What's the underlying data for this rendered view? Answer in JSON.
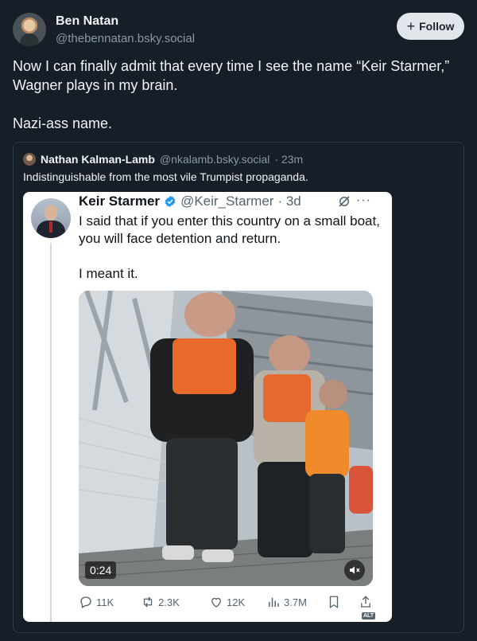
{
  "post": {
    "author_name": "Ben Natan",
    "author_handle": "@thebennatan.bsky.social",
    "follow_label": "Follow",
    "text_lines": [
      "Now I can finally admit that every time I see the name “Keir Starmer,” Wagner plays in my brain.",
      "Nazi-ass name."
    ]
  },
  "quote": {
    "author_name": "Nathan Kalman-Lamb",
    "author_handle": "@nkalamb.bsky.social",
    "time": "· 23m",
    "text": "Indistinguishable from the most vile Trumpist propaganda."
  },
  "embedded": {
    "author_name": "Keir Starmer",
    "author_handle": "@Keir_Starmer",
    "time": "· 3d",
    "text_lines": [
      "I said that if you enter this country on a small boat, you will face detention and return.",
      "I meant it."
    ],
    "video_duration": "0:24",
    "actions": {
      "replies": "11K",
      "reposts": "2.3K",
      "likes": "12K",
      "views": "3.7M",
      "alt_badge": "ALT"
    }
  },
  "colors": {
    "background": "#161e27",
    "follow_button": "#e1e6eb",
    "verified": "#1d9bf0"
  }
}
